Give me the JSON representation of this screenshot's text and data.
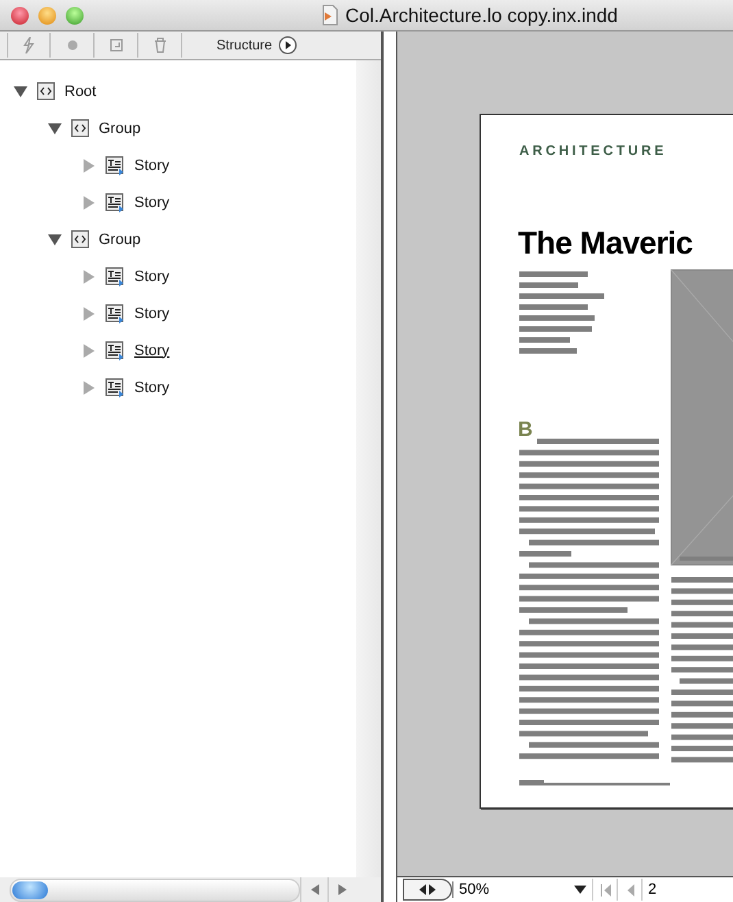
{
  "window": {
    "title": "Col.Architecture.lo copy.inx.indd"
  },
  "panel": {
    "menu_label": "Structure"
  },
  "tree": [
    {
      "label": "Root",
      "kind": "element",
      "expanded": true,
      "underlined": false,
      "children": [
        {
          "label": "Group",
          "kind": "element",
          "expanded": true,
          "underlined": false,
          "children": [
            {
              "label": "Story",
              "kind": "story",
              "expanded": false,
              "underlined": false
            },
            {
              "label": "Story",
              "kind": "story",
              "expanded": false,
              "underlined": false
            }
          ]
        },
        {
          "label": "Group",
          "kind": "element",
          "expanded": true,
          "underlined": false,
          "children": [
            {
              "label": "Story",
              "kind": "story",
              "expanded": false,
              "underlined": false
            },
            {
              "label": "Story",
              "kind": "story",
              "expanded": false,
              "underlined": false
            },
            {
              "label": "Story",
              "kind": "story",
              "expanded": false,
              "underlined": true
            },
            {
              "label": "Story",
              "kind": "story",
              "expanded": false,
              "underlined": false
            }
          ]
        }
      ]
    }
  ],
  "document": {
    "kicker": "ARCHITECTURE",
    "headline": "The Maveric",
    "drop_cap": "B"
  },
  "status_bar": {
    "zoom": "50%",
    "page": "2"
  }
}
